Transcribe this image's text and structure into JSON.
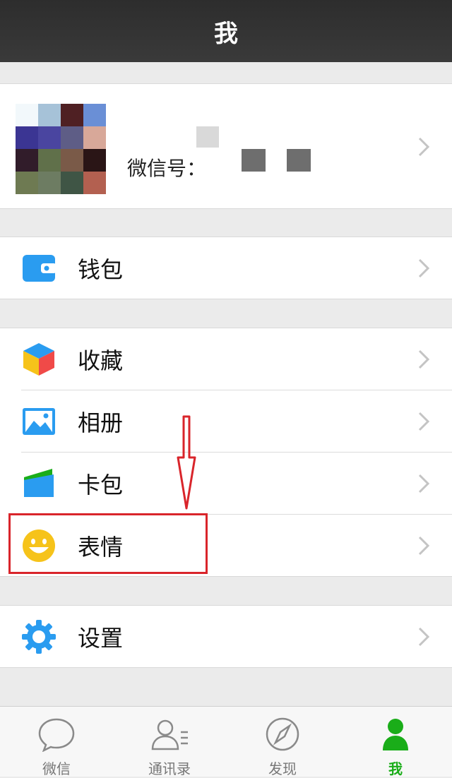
{
  "header": {
    "title": "我"
  },
  "profile": {
    "wechat_id_label": "微信号："
  },
  "menu": {
    "wallet": "钱包",
    "favorites": "收藏",
    "album": "相册",
    "cards": "卡包",
    "stickers": "表情",
    "settings": "设置"
  },
  "tabs": [
    {
      "label": "微信",
      "icon": "chat-bubble-icon"
    },
    {
      "label": "通讯录",
      "icon": "contacts-icon"
    },
    {
      "label": "发现",
      "icon": "compass-icon"
    },
    {
      "label": "我",
      "icon": "person-icon",
      "active": true
    }
  ],
  "colors": {
    "accent_green": "#1aad19",
    "annotation_red": "#d9252b",
    "icon_blue": "#2a9cf0"
  }
}
